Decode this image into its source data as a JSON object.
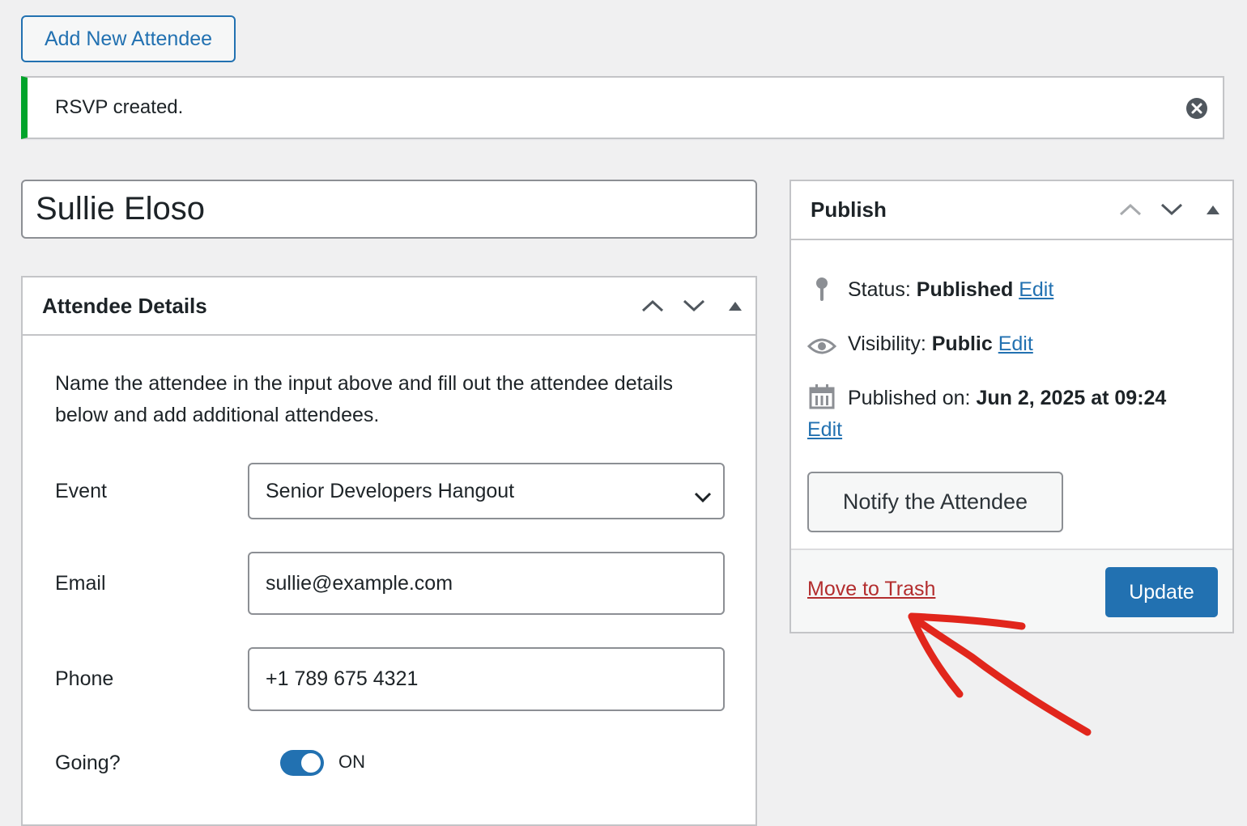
{
  "page": {
    "add_new_label": "Add New Attendee",
    "title_value": "Sullie Eloso"
  },
  "notice": {
    "message": "RSVP created.",
    "dismiss_icon": "close-circle-icon",
    "accent_color": "#00a32a"
  },
  "attendee_details": {
    "title": "Attendee Details",
    "description": "Name the attendee in the input above and fill out the attendee details below and add additional attendees.",
    "fields": {
      "event": {
        "label": "Event",
        "value": "Senior Developers Hangout"
      },
      "email": {
        "label": "Email",
        "value": "sullie@example.com"
      },
      "phone": {
        "label": "Phone",
        "value": "+1 789 675 4321"
      },
      "going": {
        "label": "Going?",
        "state": "ON"
      }
    }
  },
  "publish": {
    "title": "Publish",
    "status": {
      "label": "Status:",
      "value": "Published",
      "edit": "Edit"
    },
    "visibility": {
      "label": "Visibility:",
      "value": "Public",
      "edit": "Edit"
    },
    "published_on": {
      "label": "Published on:",
      "value": "Jun 2, 2025 at 09:24",
      "edit": "Edit"
    },
    "notify_label": "Notify the Attendee",
    "trash_label": "Move to Trash",
    "update_label": "Update"
  },
  "colors": {
    "primary": "#2271b1",
    "danger": "#b32d2e",
    "annotation": "#e1261c"
  }
}
